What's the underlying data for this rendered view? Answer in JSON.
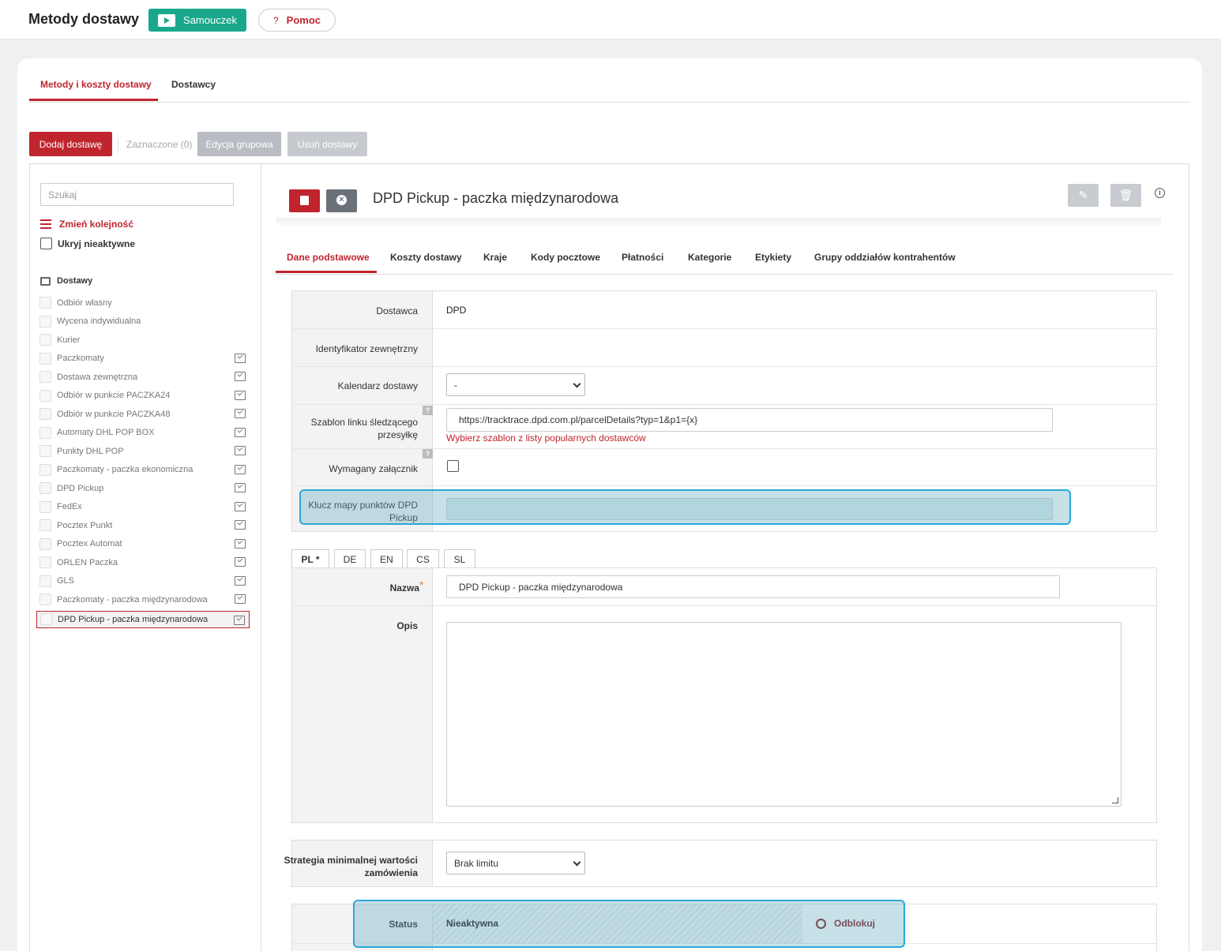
{
  "header": {
    "title": "Metody dostawy",
    "tutorial_label": "Samouczek",
    "help_label": "Pomoc",
    "help_icon": "?"
  },
  "main_tabs": [
    {
      "label": "Metody i koszty dostawy",
      "active": true
    },
    {
      "label": "Dostawcy",
      "active": false
    }
  ],
  "toolbar": {
    "add_label": "Dodaj dostawę",
    "selected_label": "Zaznaczone (0)",
    "group_edit_label": "Edycja grupowa",
    "delete_label": "Usuń dostawy"
  },
  "sidebar": {
    "search_placeholder": "Szukaj",
    "reorder_label": "Zmień kolejność",
    "hide_inactive_label": "Ukryj nieaktywne",
    "section_label": "Dostawy",
    "items": [
      {
        "label": "Odbiór własny",
        "monitor": false
      },
      {
        "label": "Wycena indywidualna",
        "monitor": false
      },
      {
        "label": "Kurier",
        "monitor": false
      },
      {
        "label": "Paczkomaty",
        "monitor": true
      },
      {
        "label": "Dostawa zewnętrzna",
        "monitor": true
      },
      {
        "label": "Odbiór w punkcie PACZKA24",
        "monitor": true
      },
      {
        "label": "Odbiór w punkcie PACZKA48",
        "monitor": true
      },
      {
        "label": "Automaty DHL POP BOX",
        "monitor": true
      },
      {
        "label": "Punkty DHL POP",
        "monitor": true
      },
      {
        "label": "Paczkomaty - paczka ekonomiczna",
        "monitor": true
      },
      {
        "label": "DPD Pickup",
        "monitor": true
      },
      {
        "label": "FedEx",
        "monitor": true
      },
      {
        "label": "Pocztex Punkt",
        "monitor": true
      },
      {
        "label": "Pocztex Automat",
        "monitor": true
      },
      {
        "label": "ORLEN Paczka",
        "monitor": true
      },
      {
        "label": "GLS",
        "monitor": true
      },
      {
        "label": "Paczkomaty - paczka międzynarodowa",
        "monitor": true
      },
      {
        "label": "DPD Pickup - paczka międzynarodowa",
        "monitor": true,
        "selected": true
      }
    ]
  },
  "detail": {
    "title": "DPD Pickup - paczka międzynarodowa",
    "info_icon": "i",
    "tabs": [
      "Dane podstawowe",
      "Koszty dostawy",
      "Kraje",
      "Kody pocztowe",
      "Płatności",
      "Kategorie",
      "Etykiety",
      "Grupy oddziałów kontrahentów"
    ],
    "fields": {
      "provider_label": "Dostawca",
      "provider_value": "DPD",
      "external_id_label": "Identyfikator zewnętrzny",
      "calendar_label": "Kalendarz dostawy",
      "calendar_value": "-",
      "tracking_label": "Szablon linku śledzącego przesyłkę",
      "tracking_value": "https://tracktrace.dpd.com.pl/parcelDetails?typ=1&p1={x}",
      "tracking_hint": "Wybierz szablon z listy popularnych dostawców",
      "attachment_label": "Wymagany załącznik",
      "map_key_label": "Klucz mapy punktów DPD Pickup",
      "map_key_value": "",
      "help_mark": "?"
    },
    "languages": [
      "PL *",
      "DE",
      "EN",
      "CS",
      "SL"
    ],
    "name_label": "Nazwa",
    "name_required": "*",
    "name_value": "DPD Pickup - paczka międzynarodowa",
    "description_label": "Opis",
    "strategy_label": "Strategia minimalnej wartości zamówienia",
    "strategy_value": "Brak limitu",
    "status_label": "Status",
    "status_value": "Nieaktywna",
    "unlock_label": "Odblokuj"
  },
  "colors": {
    "accent": "#c0252e",
    "teal": "#1aa88c",
    "highlight": "#2aa8d8"
  }
}
